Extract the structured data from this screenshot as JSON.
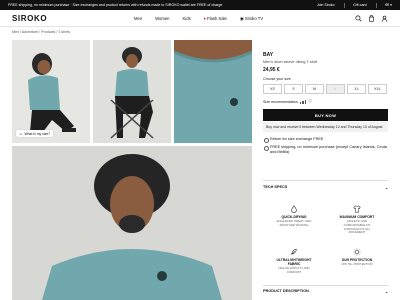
{
  "promo": {
    "message": "FREE shipping, no minimum purchase · Size exchanges and product returns with refunds made to SIROKO wallet are FREE of charge",
    "join": "Join Siroko",
    "gift_card": "Gift card",
    "currency": "€€"
  },
  "header": {
    "logo": "SIROKO",
    "nav": [
      "Men",
      "Women",
      "Kids",
      "Flash Sale",
      "Siroko TV"
    ]
  },
  "breadcrumb": "Men / Adventure / Products / T-shirts",
  "gallery": {
    "fit_button": "What is my size?"
  },
  "product": {
    "brand": "BAY",
    "name": "Men's short sleeve hiking T-shirt",
    "price": "24,95 €",
    "choose_size": "Choose your size",
    "sizes": [
      "XS",
      "S",
      "M",
      "L",
      "XL",
      "XXL"
    ],
    "selected_size": "L",
    "size_recommendation": "Size recommendation",
    "buy_label": "BUY NOW",
    "delivery_note": "Buy now and receive it between Wednesday 12 and Thursday 13 of August",
    "options": [
      "Return for size exchange FREE",
      "FREE shipping, no minimum purchase (except Canary Islands, Ceuta and Melilla)"
    ]
  },
  "tech_specs": {
    "title": "TECH SPECS",
    "features": [
      {
        "title": "QUICK-DRYING",
        "desc": "ENHANCED SWEAT- AND MOISTURE WICKING",
        "icon": "droplet-icon"
      },
      {
        "title": "MAXIMUM COMFORT",
        "desc": "ATHLETIC AND COMFORTABLE FIT THROUGHOUT ALL MOVEMENT",
        "icon": "shirt-icon"
      },
      {
        "title": "ULTRALIGHTWEIGHT FABRIC",
        "desc": "HIGH ELASTICITY AND COMFORT",
        "icon": "feather-icon"
      },
      {
        "title": "SUN PROTECTION",
        "desc": "UPF 50+ PROTECTION",
        "icon": "sun-icon"
      }
    ]
  },
  "product_description": {
    "title": "PRODUCT DESCRIPTION"
  },
  "colors": {
    "shirt": "#70a8ad",
    "accent": "#111111"
  }
}
